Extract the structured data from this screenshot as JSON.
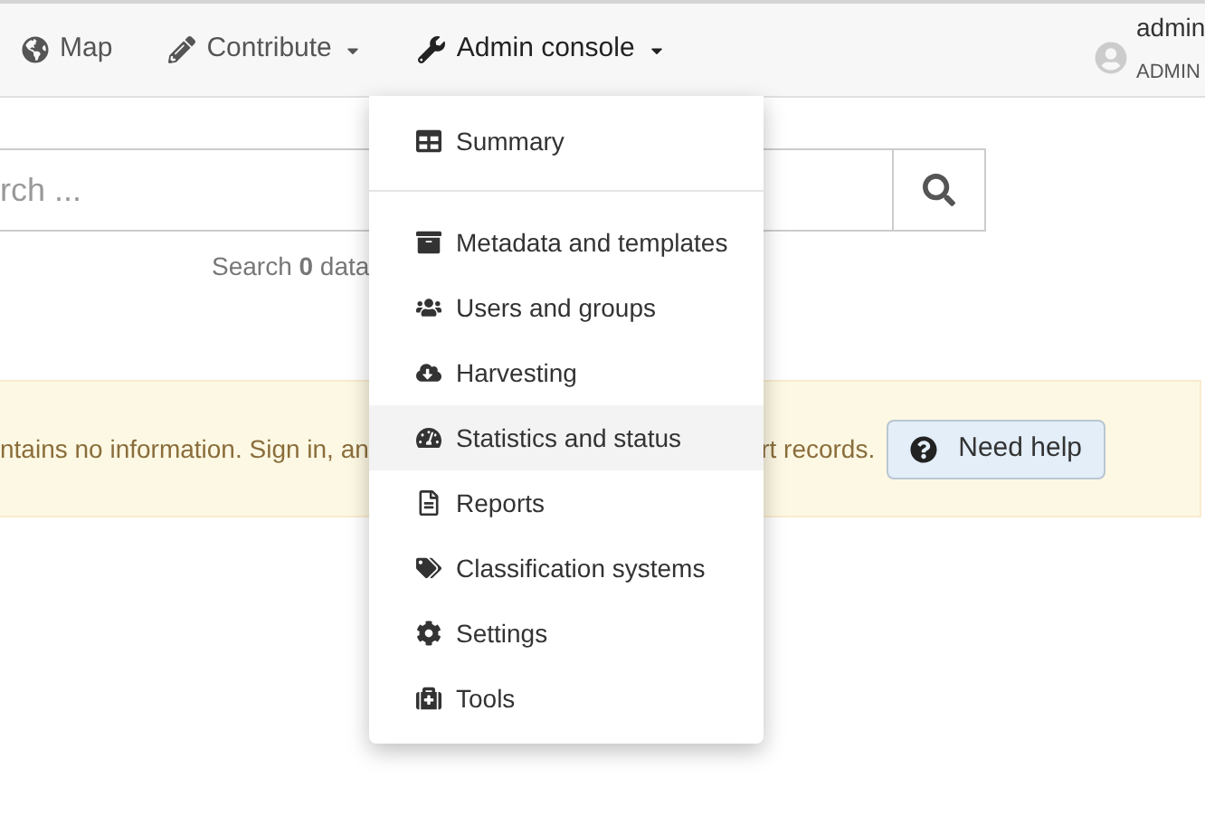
{
  "navbar": {
    "items": [
      {
        "label": "Map",
        "kind": "link",
        "selected": false
      },
      {
        "label": "Contribute",
        "kind": "dropdown",
        "selected": false
      },
      {
        "label": "Admin console",
        "kind": "dropdown",
        "selected": true
      }
    ],
    "user": {
      "name": "admin",
      "role": "ADMIN"
    }
  },
  "search": {
    "placeholder": "rch ...",
    "summary": "Search **0** data"
  },
  "alert": {
    "text_left": "ntains no information. Sign in, an",
    "text_right": "rt records.",
    "button": "Need help"
  },
  "admin_menu": {
    "groups": [
      [
        {
          "label": "Summary",
          "selected": false
        }
      ],
      [
        {
          "label": "Metadata and templates",
          "selected": false
        },
        {
          "label": "Users and groups",
          "selected": false
        },
        {
          "label": "Harvesting",
          "selected": false
        },
        {
          "label": "Statistics and status",
          "selected": true
        },
        {
          "label": "Reports",
          "selected": false
        },
        {
          "label": "Classification systems",
          "selected": false
        },
        {
          "label": "Settings",
          "selected": false
        },
        {
          "label": "Tools",
          "selected": false
        }
      ]
    ]
  }
}
